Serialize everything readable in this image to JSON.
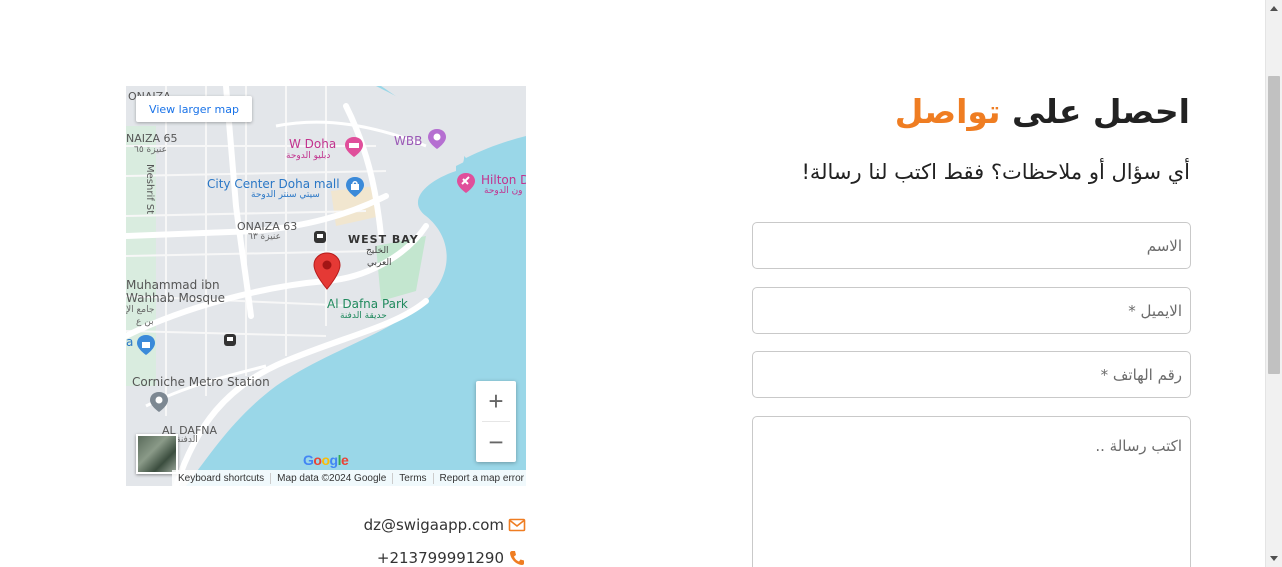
{
  "map": {
    "view_larger": "View larger map",
    "labels": {
      "onaiza_top": "ONAIZA",
      "onaiza_65": "NAIZA 65",
      "onaiza_65_ar": "عنيزة ٦٥",
      "meshrif": "Meshrif St",
      "w_doha": "W Doha",
      "w_doha_ar": "دبليو الدوحة",
      "wbb": "WBB",
      "hilton": "Hilton D",
      "hilton_ar": "ون الدوحة",
      "city_center": "City Center Doha mall",
      "city_center_ar": "سيتي سنتر الدوحة",
      "onaiza_63": "ONAIZA 63",
      "onaiza_63_ar": "عنيزة ٦٣",
      "west_bay": "WEST BAY",
      "west_bay_ar1": "الخليج",
      "west_bay_ar2": "العربي",
      "mosque1": "Muhammad ibn",
      "mosque2": "Wahhab Mosque",
      "mosque_ar1": "جامع الإ",
      "mosque_ar2": "بن ع",
      "al_dafna_park": "Al Dafna Park",
      "al_dafna_park_ar": "حديقة الدفنة",
      "corniche": "Corniche Metro Station",
      "al_dafna": "AL DAFNA",
      "al_dafna_ar": "الدفنة",
      "edge_a": "a"
    },
    "zoom_in": "+",
    "zoom_out": "−",
    "google": "Google",
    "attribution": {
      "shortcuts": "Keyboard shortcuts",
      "data": "Map data ©2024 Google",
      "terms": "Terms",
      "report": "Report a map error"
    },
    "icons": [
      "map-pin-icon",
      "hotel-icon",
      "shopping-bag-icon",
      "camera-icon",
      "transit-icon",
      "metro-station-icon",
      "layers-icon"
    ],
    "colors": {
      "water": "#9ad7e8",
      "land": "#dfe3e8",
      "park": "#c3e6cf",
      "road": "#ffffff",
      "pin": "#e53935"
    }
  },
  "contact": {
    "email": "dz@swigaapp.com",
    "phone": "+213799991290",
    "icons": [
      "envelope-icon",
      "phone-icon"
    ],
    "icon_color": "#ef7d22"
  },
  "form": {
    "heading_prefix": "احصل على",
    "heading_accent": "تواصل",
    "accent_color": "#ef7d22",
    "subheading": "أي سؤال أو ملاحظات؟ فقط اكتب لنا رسالة!",
    "name_placeholder": "الاسم",
    "email_placeholder": "الايميل *",
    "phone_placeholder": "رقم الهاتف *",
    "message_placeholder": "اكتب رسالة .."
  }
}
